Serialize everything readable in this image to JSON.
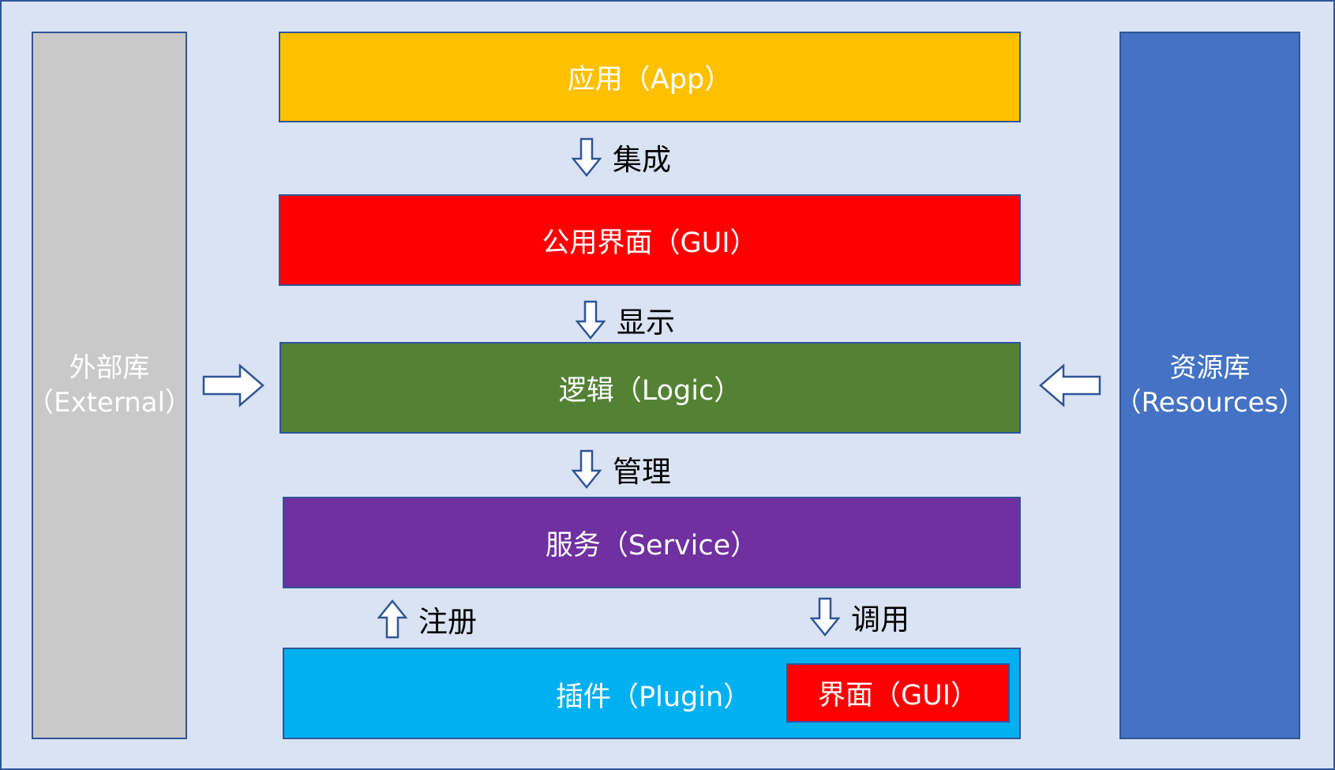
{
  "layers": {
    "app": {
      "label": "应用（App）",
      "color": "#ffc000"
    },
    "gui": {
      "label": "公用界面（GUI）",
      "color": "#ff0000"
    },
    "logic": {
      "label": "逻辑（Logic）",
      "color": "#548235"
    },
    "service": {
      "label": "服务（Service）",
      "color": "#7030a0"
    },
    "plugin": {
      "label": "插件（Plugin）",
      "color": "#00b0f0"
    },
    "plugin_gui": {
      "label": "界面（GUI）",
      "color": "#ff0000"
    }
  },
  "external": {
    "line1": "外部库",
    "line2": "（External）",
    "color": "#c9c9c9"
  },
  "resources": {
    "line1": "资源库",
    "line2": "（Resources）",
    "color": "#4472c4"
  },
  "edges": {
    "integrate": "集成",
    "display": "显示",
    "manage": "管理",
    "register": "注册",
    "call": "调用"
  }
}
